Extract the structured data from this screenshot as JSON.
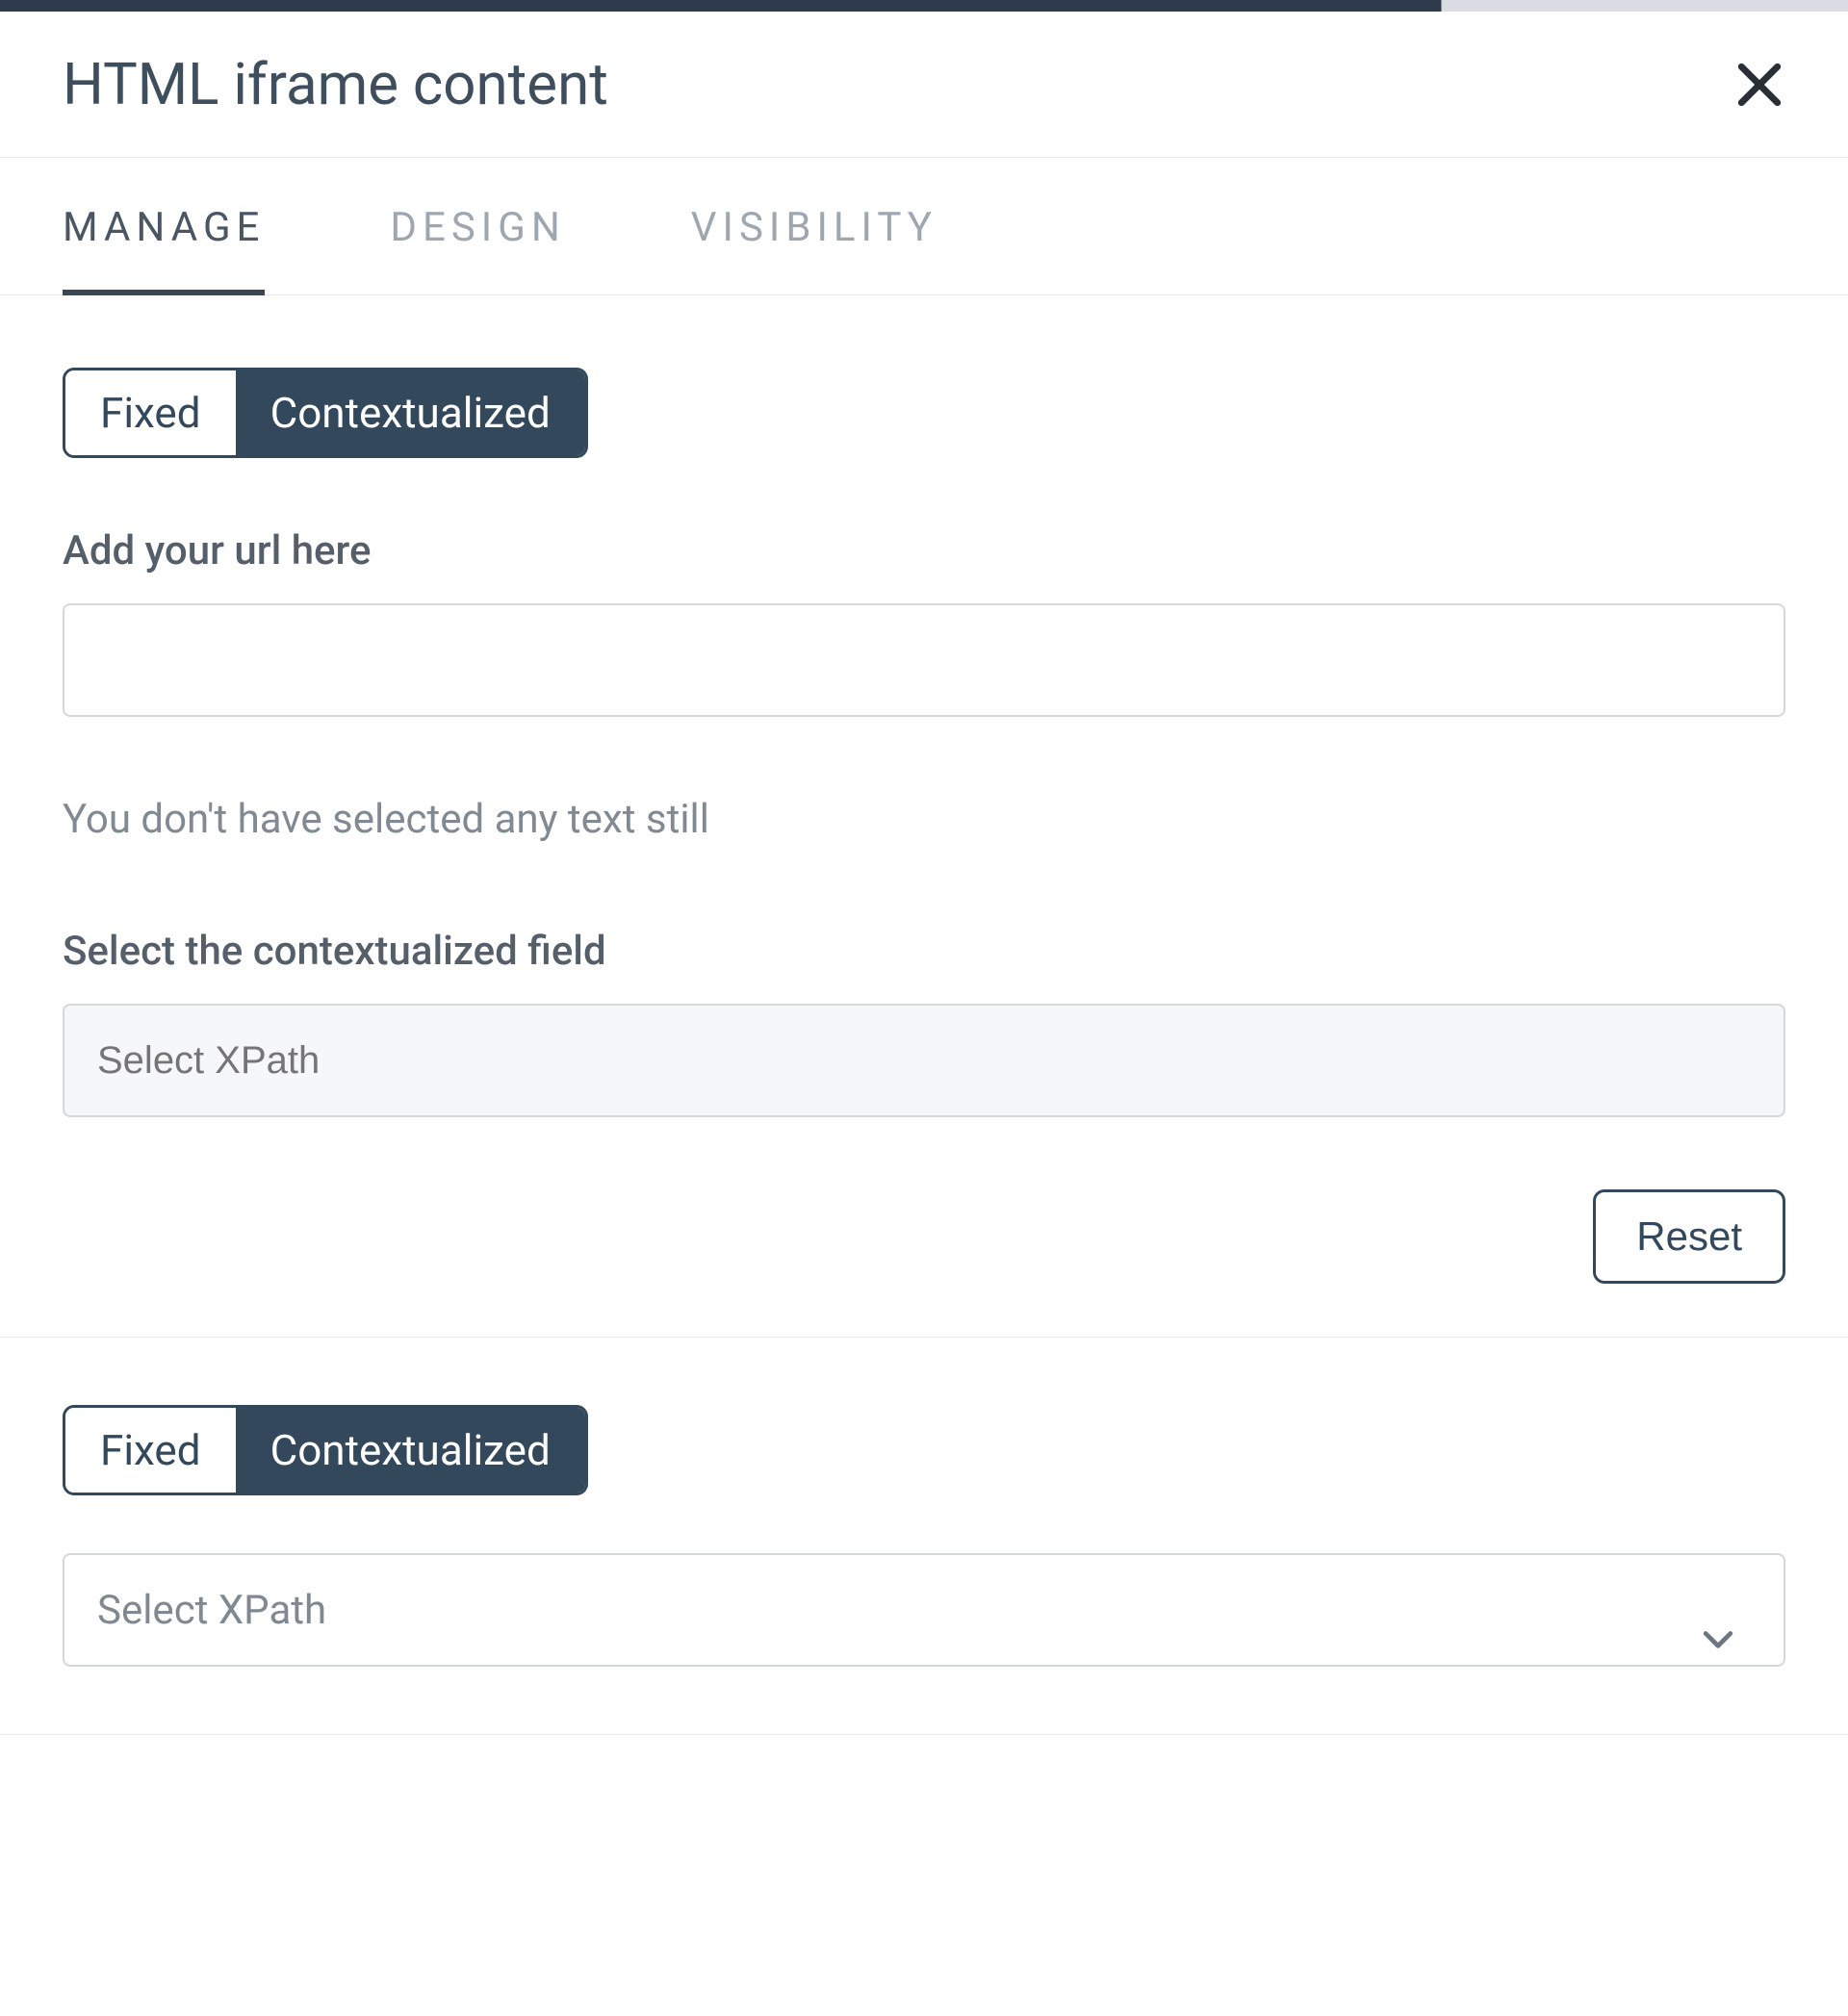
{
  "header": {
    "title": "HTML iframe content"
  },
  "tabs": {
    "manage": "MANAGE",
    "design": "DESIGN",
    "visibility": "VISIBILITY"
  },
  "section1": {
    "toggle": {
      "fixed": "Fixed",
      "contextualized": "Contextualized"
    },
    "url_label": "Add your url here",
    "url_value": "",
    "helper": "You don't have selected any text still",
    "ctx_label": "Select the contextualized field",
    "xpath_placeholder": "Select XPath",
    "reset": "Reset"
  },
  "section2": {
    "toggle": {
      "fixed": "Fixed",
      "contextualized": "Contextualized"
    },
    "xpath_placeholder": "Select XPath"
  }
}
